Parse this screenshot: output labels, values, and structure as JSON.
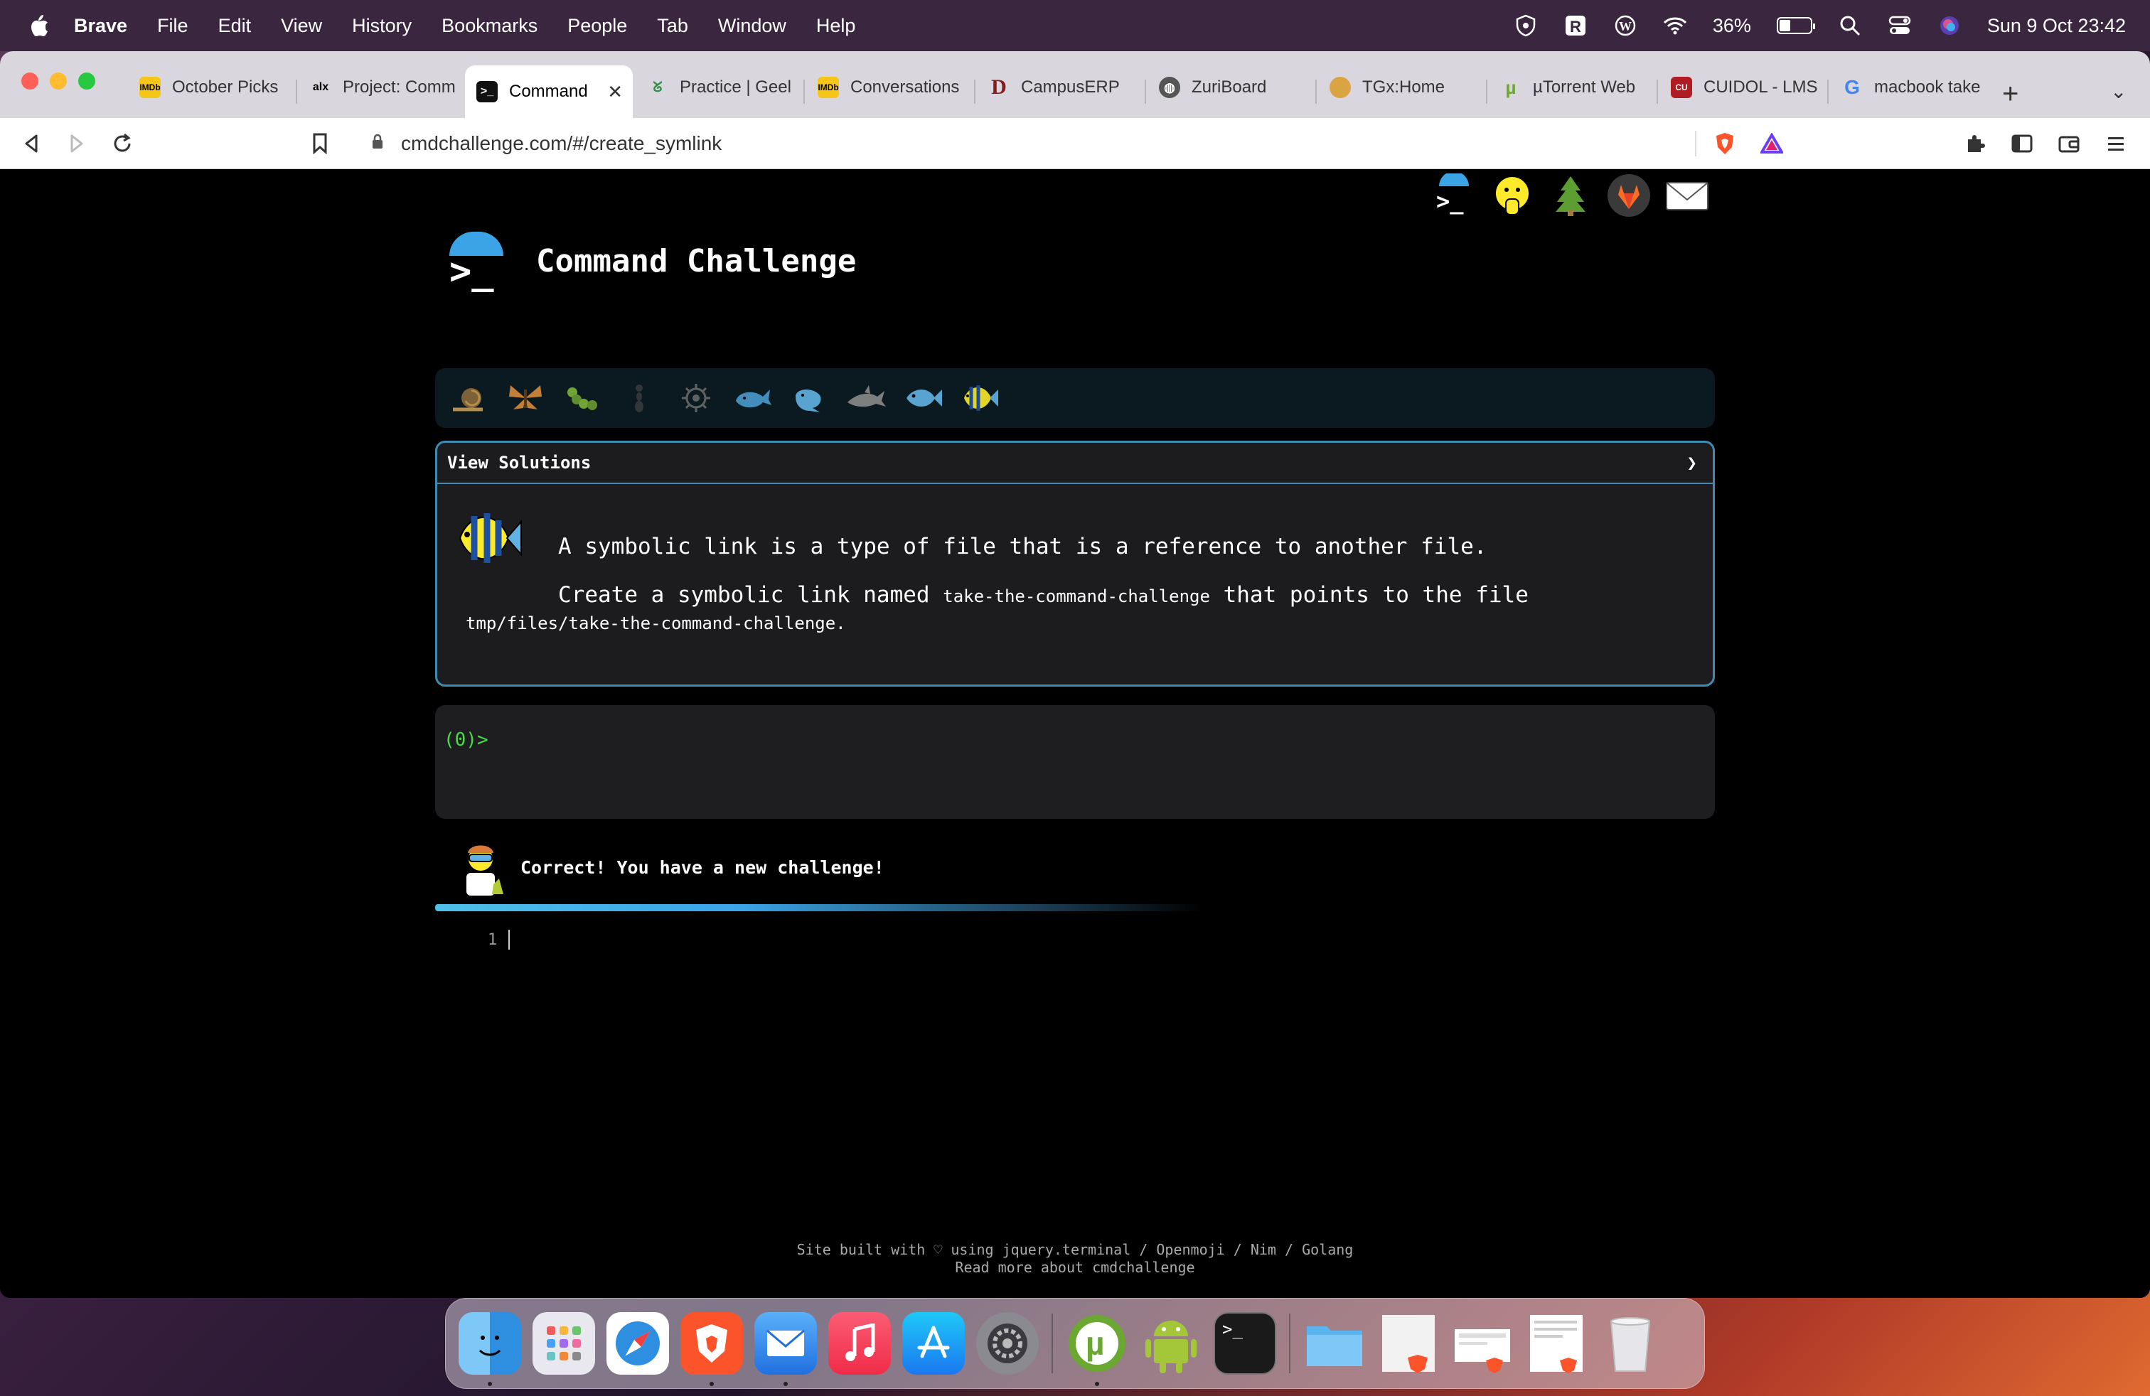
{
  "menubar": {
    "app_name": "Brave",
    "items": [
      "File",
      "Edit",
      "View",
      "History",
      "Bookmarks",
      "People",
      "Tab",
      "Window",
      "Help"
    ],
    "battery_percent": "36%",
    "battery_level": 0.36,
    "datetime": "Sun 9 Oct  23:42"
  },
  "tabs": [
    {
      "label": "October Picks",
      "favicon": "imdb-icon",
      "color": "#f5c518"
    },
    {
      "label": "Project: Comm",
      "favicon": "alx-icon",
      "color": "#ffffff"
    },
    {
      "label": "Command",
      "favicon": "terminal-icon",
      "color": "#111111"
    },
    {
      "label": "Practice | Geel",
      "favicon": "geeks-icon",
      "color": "#2f8d46"
    },
    {
      "label": "Conversations",
      "favicon": "imdb-icon",
      "color": "#f5c518"
    },
    {
      "label": "CampusERP",
      "favicon": "d-icon",
      "color": "#ffffff"
    },
    {
      "label": "ZuriBoard",
      "favicon": "globe-icon",
      "color": "#555555"
    },
    {
      "label": "TGx:Home",
      "favicon": "tgx-icon",
      "color": "#d9a441"
    },
    {
      "label": "µTorrent Web",
      "favicon": "utorrent-icon",
      "color": "#6aa832"
    },
    {
      "label": "CUIDOL - LMS",
      "favicon": "cu-icon",
      "color": "#b01c24"
    },
    {
      "label": "macbook take",
      "favicon": "google-icon",
      "color": "#ffffff"
    }
  ],
  "address": {
    "url": "cmdchallenge.com/#/create_symlink"
  },
  "page": {
    "title": "Command Challenge",
    "view_solutions": "View Solutions",
    "chevron": "❯",
    "description_line1": "A symbolic link is a type of file that is a reference to another file.",
    "description_line2_pre": "Create a symbolic link named ",
    "description_code": "take-the-command-challenge",
    "description_line2_post": " that points to the file",
    "description_path": "tmp/files/take-the-command-challenge.",
    "prompt": "(0)>",
    "feedback": "Correct! You have a new challenge!",
    "editor_line": "1",
    "footer_line1": "Site built with ♡ using jquery.terminal / Openmoji / Nim / Golang",
    "footer_line2": "Read more about cmdchallenge"
  },
  "colors": {
    "accent": "#3aa4e6",
    "border": "#3f8ab0",
    "prompt": "#3fe03f",
    "background": "#000000"
  },
  "dock": {
    "apps": [
      "finder-icon",
      "launchpad-icon",
      "safari-icon",
      "brave-icon",
      "mail-icon",
      "music-icon",
      "app-store-icon",
      "system-preferences-icon",
      "utorrent-icon",
      "android-icon",
      "terminal-icon",
      "folder-icon",
      "document-icon",
      "document-icon",
      "document-icon",
      "trash-icon"
    ]
  }
}
